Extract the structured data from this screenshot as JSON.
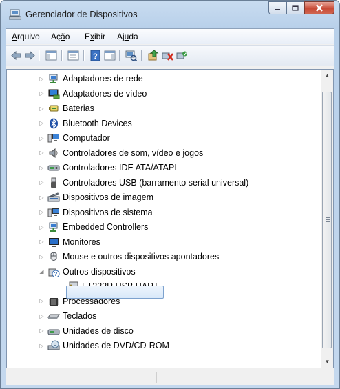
{
  "window": {
    "title": "Gerenciador de Dispositivos"
  },
  "menu": [
    {
      "label": "Arquivo",
      "underline_index": 0
    },
    {
      "label": "Ação",
      "underline_index": 2
    },
    {
      "label": "Exibir",
      "underline_index": 1
    },
    {
      "label": "Ajuda",
      "underline_index": 2
    }
  ],
  "toolbar": {
    "buttons": [
      "back-arrow-icon",
      "forward-arrow-icon",
      "show-hide-console-tree-icon",
      "properties-icon",
      "help-icon",
      "action-pane-icon",
      "scan-hardware-icon",
      "update-driver-icon",
      "uninstall-icon",
      "enable-device-icon"
    ]
  },
  "tree": {
    "items": [
      {
        "label": "Adaptadores de rede",
        "icon": "network-adapter-icon",
        "expanded": false
      },
      {
        "label": "Adaptadores de vídeo",
        "icon": "display-adapter-icon",
        "expanded": false
      },
      {
        "label": "Baterias",
        "icon": "battery-icon",
        "expanded": false
      },
      {
        "label": "Bluetooth Devices",
        "icon": "bluetooth-icon",
        "expanded": false
      },
      {
        "label": "Computador",
        "icon": "computer-icon",
        "expanded": false
      },
      {
        "label": "Controladores de som, vídeo e jogos",
        "icon": "speaker-icon",
        "expanded": false
      },
      {
        "label": "Controladores IDE ATA/ATAPI",
        "icon": "ide-controller-icon",
        "expanded": false
      },
      {
        "label": "Controladores USB (barramento serial universal)",
        "icon": "usb-icon",
        "expanded": false
      },
      {
        "label": "Dispositivos de imagem",
        "icon": "scanner-icon",
        "expanded": false
      },
      {
        "label": "Dispositivos de sistema",
        "icon": "system-device-icon",
        "expanded": false
      },
      {
        "label": "Embedded Controllers",
        "icon": "embedded-controller-icon",
        "expanded": false
      },
      {
        "label": "Monitores",
        "icon": "monitor-icon",
        "expanded": false
      },
      {
        "label": "Mouse e outros dispositivos apontadores",
        "icon": "mouse-icon",
        "expanded": false
      },
      {
        "label": "Outros dispositivos",
        "icon": "unknown-device-icon",
        "expanded": true
      },
      {
        "label": "FT232R USB UART",
        "icon": "warning-device-icon",
        "child": true,
        "selected": true
      },
      {
        "label": "Processadores",
        "icon": "processor-icon",
        "expanded": false
      },
      {
        "label": "Teclados",
        "icon": "keyboard-icon",
        "expanded": false
      },
      {
        "label": "Unidades de disco",
        "icon": "disk-drive-icon",
        "expanded": false
      },
      {
        "label": "Unidades de DVD/CD-ROM",
        "icon": "dvd-drive-icon",
        "expanded": false
      }
    ]
  },
  "colors": {
    "title_bar": "#c9dcf0",
    "selection": "#d8e8f9",
    "close_button": "#c84a36"
  }
}
